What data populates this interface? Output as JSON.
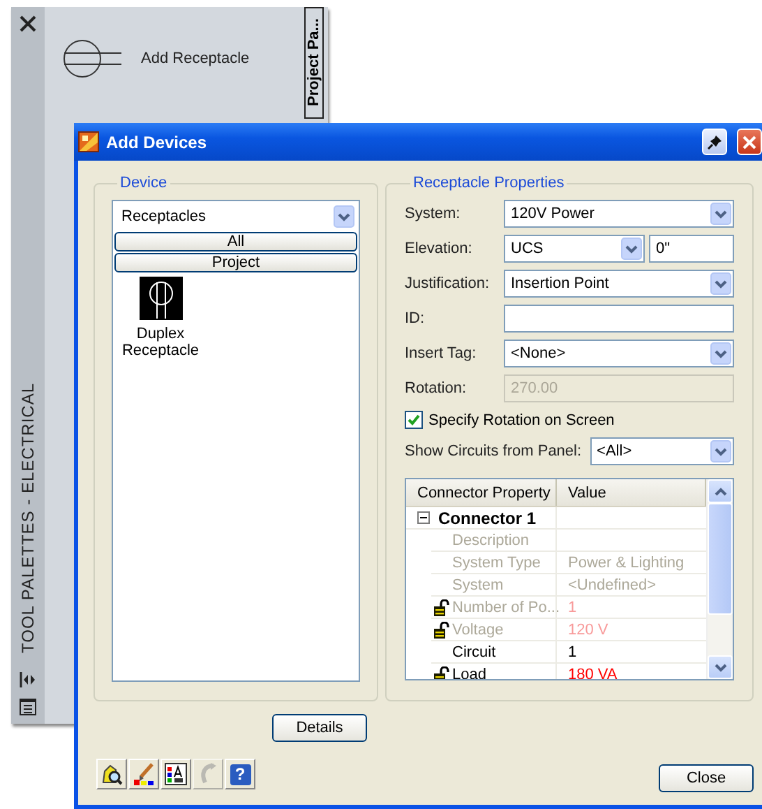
{
  "palette": {
    "title": "TOOL PALETTES - ELECTRICAL",
    "tab": "Project Pa...",
    "tools": [
      {
        "label": "Add Receptacle"
      }
    ]
  },
  "dialog": {
    "title": "Add Devices",
    "device": {
      "title": "Device",
      "category": "Receptacles",
      "filters": [
        "All",
        "Project"
      ],
      "items": [
        {
          "label": "Duplex Receptacle",
          "selected": false
        }
      ]
    },
    "properties": {
      "title": "Receptacle Properties",
      "fields": [
        {
          "kind": "combo",
          "label": "System:",
          "value": "120V Power",
          "disabled": false
        },
        {
          "kind": "combo_text",
          "label": "Elevation:",
          "value": "UCS",
          "text": "0\"",
          "disabled": false
        },
        {
          "kind": "combo",
          "label": "Justification:",
          "value": "Insertion Point",
          "disabled": false
        },
        {
          "kind": "text",
          "label": "ID:",
          "disabled": false
        },
        {
          "kind": "combo",
          "label": "Insert Tag:",
          "value": "<None>",
          "disabled": false
        },
        {
          "kind": "text",
          "label": "Rotation:",
          "value": "270.00",
          "disabled": true
        }
      ],
      "rotation_checkbox": {
        "label": "Specify Rotation on Screen",
        "checked": true
      },
      "panel_filter": {
        "label": "Show Circuits from Panel:",
        "value": "<All>"
      },
      "grid": {
        "columns": [
          "Connector Property",
          "Value"
        ],
        "rows": [
          {
            "property": "Connector 1",
            "expanded": true,
            "children": [
              {
                "property": "Description",
                "disabled": true,
                "locked": false,
                "flagged": false
              },
              {
                "property": "System Type",
                "value": "Power & Lighting",
                "disabled": true,
                "locked": false,
                "flagged": false
              },
              {
                "property": "System",
                "value": "<Undefined>",
                "disabled": true,
                "locked": false,
                "flagged": false
              },
              {
                "property": "Number of Po...",
                "value": "1",
                "disabled": true,
                "locked": true,
                "flagged": true
              },
              {
                "property": "Voltage",
                "value": "120 V",
                "disabled": true,
                "locked": true,
                "flagged": true
              },
              {
                "property": "Circuit",
                "value": "1",
                "disabled": false,
                "locked": false,
                "flagged": false
              },
              {
                "property": "Load",
                "value": "180 VA",
                "disabled": false,
                "locked": true,
                "flagged": true
              }
            ]
          }
        ]
      }
    },
    "details_button": "Details",
    "toolbar": [
      {
        "kind": "browse",
        "disabled": false
      },
      {
        "kind": "brush",
        "disabled": false
      },
      {
        "kind": "style",
        "disabled": false
      },
      {
        "kind": "undo",
        "disabled": true
      },
      {
        "kind": "help",
        "glyph": "?",
        "disabled": false
      }
    ],
    "close_button": "Close"
  }
}
